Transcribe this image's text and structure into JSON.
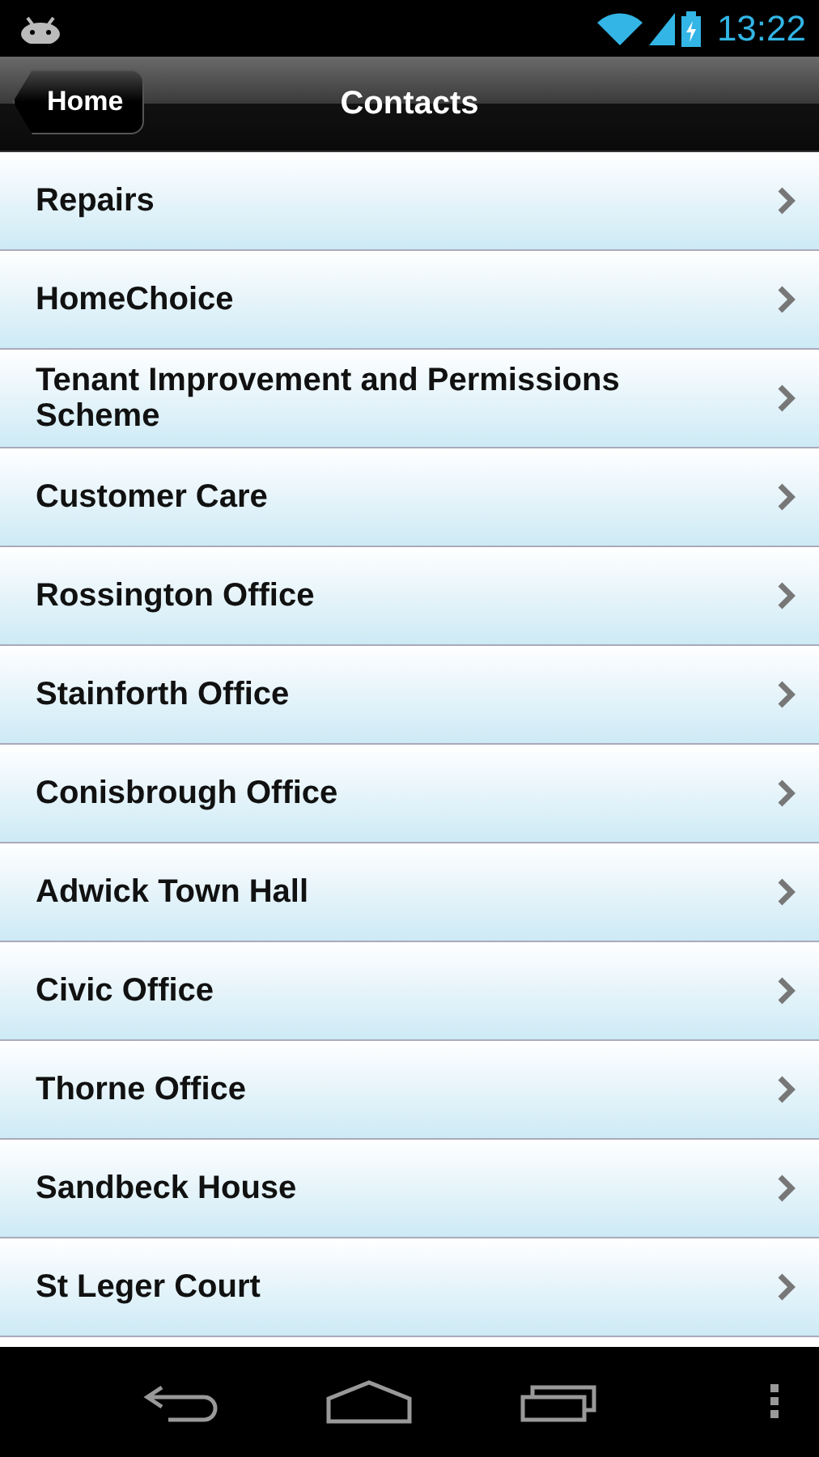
{
  "status_bar": {
    "time": "13:22"
  },
  "nav_bar": {
    "back_button": "Home",
    "title": "Contacts"
  },
  "contacts": [
    {
      "label": "Repairs"
    },
    {
      "label": "HomeChoice"
    },
    {
      "label": "Tenant Improvement and Permissions Scheme"
    },
    {
      "label": "Customer Care"
    },
    {
      "label": "Rossington Office"
    },
    {
      "label": "Stainforth Office"
    },
    {
      "label": "Conisbrough Office"
    },
    {
      "label": "Adwick Town Hall"
    },
    {
      "label": "Civic Office"
    },
    {
      "label": "Thorne Office"
    },
    {
      "label": "Sandbeck House"
    },
    {
      "label": "St Leger Court"
    }
  ]
}
